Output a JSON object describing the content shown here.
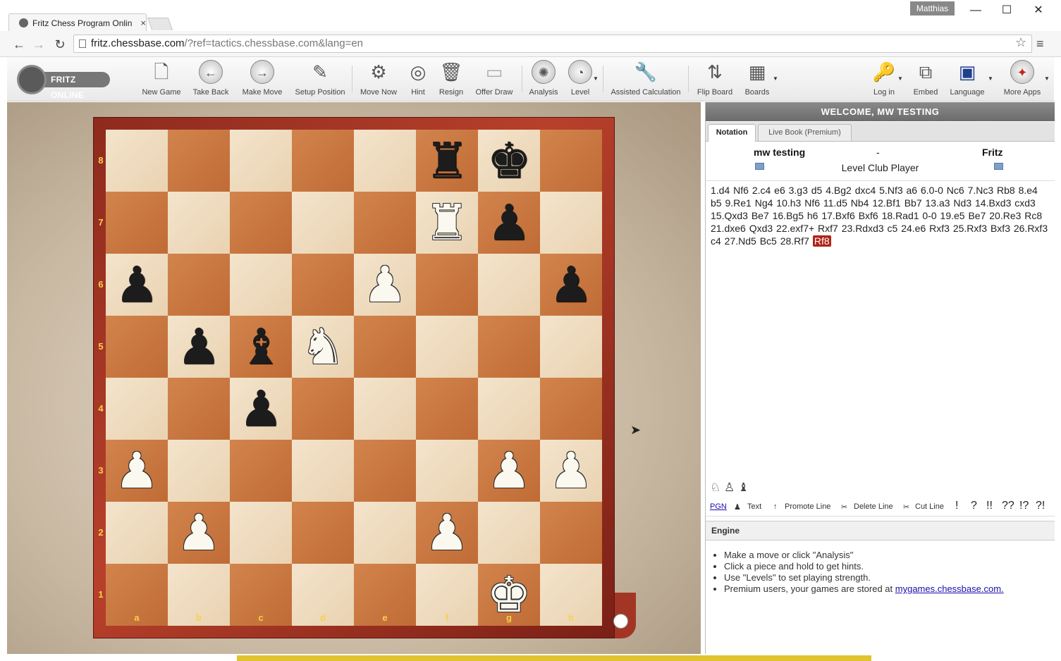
{
  "browser": {
    "tab_title": "Fritz Chess Program Onlin",
    "tab_close": "×",
    "user": "Matthias",
    "win_minimize": "—",
    "win_maximize": "☐",
    "win_close": "✕",
    "url_host": "fritz.chessbase.com",
    "url_rest": "/?ref=tactics.chessbase.com&lang=en"
  },
  "logo": {
    "text": "FRITZ ONLINE"
  },
  "toolbar": {
    "new_game": "New Game",
    "take_back": "Take Back",
    "make_move": "Make Move",
    "setup_position": "Setup Position",
    "move_now": "Move Now",
    "hint": "Hint",
    "resign": "Resign",
    "offer_draw": "Offer Draw",
    "analysis": "Analysis",
    "level": "Level",
    "assisted_calculation": "Assisted Calculation",
    "flip_board": "Flip Board",
    "boards": "Boards",
    "log_in": "Log in",
    "embed": "Embed",
    "language": "Language",
    "more_apps": "More Apps"
  },
  "board": {
    "files": [
      "a",
      "b",
      "c",
      "d",
      "e",
      "f",
      "g",
      "h"
    ],
    "ranks": [
      "8",
      "7",
      "6",
      "5",
      "4",
      "3",
      "2",
      "1"
    ],
    "position": [
      [
        "",
        "",
        "",
        "",
        "",
        "r",
        "k",
        ""
      ],
      [
        "",
        "",
        "",
        "",
        "",
        "R",
        "p",
        ""
      ],
      [
        "p",
        "",
        "",
        "",
        "P",
        "",
        "",
        "p"
      ],
      [
        "",
        "p",
        "b",
        "N",
        "",
        "",
        "",
        ""
      ],
      [
        "",
        "",
        "p",
        "",
        "",
        "",
        "",
        ""
      ],
      [
        "P",
        "",
        "",
        "",
        "",
        "",
        "P",
        "P"
      ],
      [
        "",
        "P",
        "",
        "",
        "",
        "P",
        "",
        ""
      ],
      [
        "",
        "",
        "",
        "",
        "",
        "",
        "K",
        ""
      ]
    ]
  },
  "panel": {
    "welcome": "WELCOME, MW TESTING",
    "tabs": [
      "Notation",
      "Live Book (Premium)"
    ],
    "white_player": "mw testing",
    "separator": "-",
    "black_player": "Fritz",
    "level": "Level Club Player",
    "moves_text": "1.d4  Nf6  2.c4  e6  3.g3  d5  4.Bg2  dxc4  5.Nf3  a6  6.0-0  Nc6  7.Nc3 Rb8  8.e4  b5  9.Re1  Ng4  10.h3  Nf6  11.d5  Nb4  12.Bf1  Bb7  13.a3  Nd3 14.Bxd3  cxd3  15.Qxd3  Be7  16.Bg5  h6  17.Bxf6  Bxf6  18.Rad1  0-0 19.e5  Be7  20.Re3  Rc8  21.dxe6  Qxd3  22.exf7+  Rxf7  23.Rdxd3  c5 24.e6  Rxf3  25.Rxf3  Bxf3  26.Rxf3  c4  27.Nd5  Bc5  28.Rf7 ",
    "current_move": "Rf8",
    "edit": {
      "pgn": "PGN",
      "text": "Text",
      "promote_line": "Promote Line",
      "delete_line": "Delete Line",
      "cut_line": "Cut Line",
      "symbols": [
        "!",
        "?",
        "!!",
        "??",
        "!?",
        "?!"
      ]
    },
    "engine_title": "Engine",
    "tips": [
      "Make a move or click \"Analysis\"",
      "Click a piece and hold to get hints.",
      "Use \"Levels\" to set playing strength.",
      "Premium users, your games are stored at "
    ],
    "tips_link": "mygames.chessbase.com."
  },
  "colors": {
    "board_light": "#f4e4cc",
    "board_dark": "#c06b36",
    "frame": "#b7402b",
    "coord": "#f5d24a",
    "current_move_bg": "#b02418",
    "panel_header": "#7a7a7a"
  }
}
